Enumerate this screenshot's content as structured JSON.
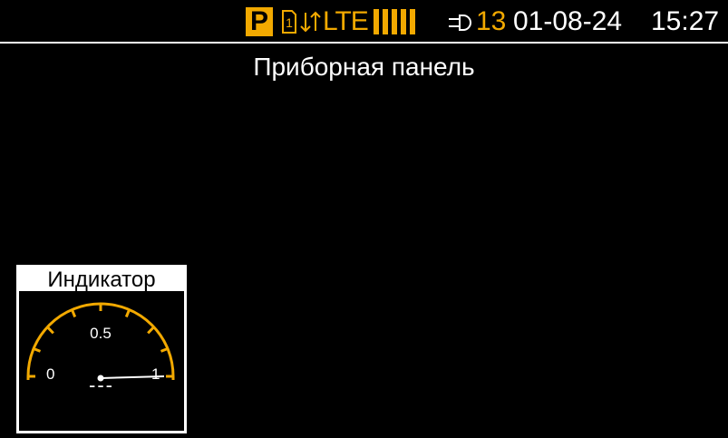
{
  "status_bar": {
    "mode": "P",
    "sim_slot": "1",
    "network": "LTE",
    "connections_count": "13",
    "date": "01-08-24",
    "time": "15:27",
    "icons": [
      "sim-card-icon",
      "data-transfer-icon",
      "signal-strength-icon",
      "plug-icon"
    ]
  },
  "page": {
    "title": "Приборная панель"
  },
  "widget": {
    "title": "Индикатор",
    "gauge": {
      "min_label": "0",
      "mid_label": "0.5",
      "max_label": "1",
      "value_text": "---"
    }
  },
  "colors": {
    "accent": "#f2a900",
    "background": "#000000",
    "text": "#ffffff"
  }
}
